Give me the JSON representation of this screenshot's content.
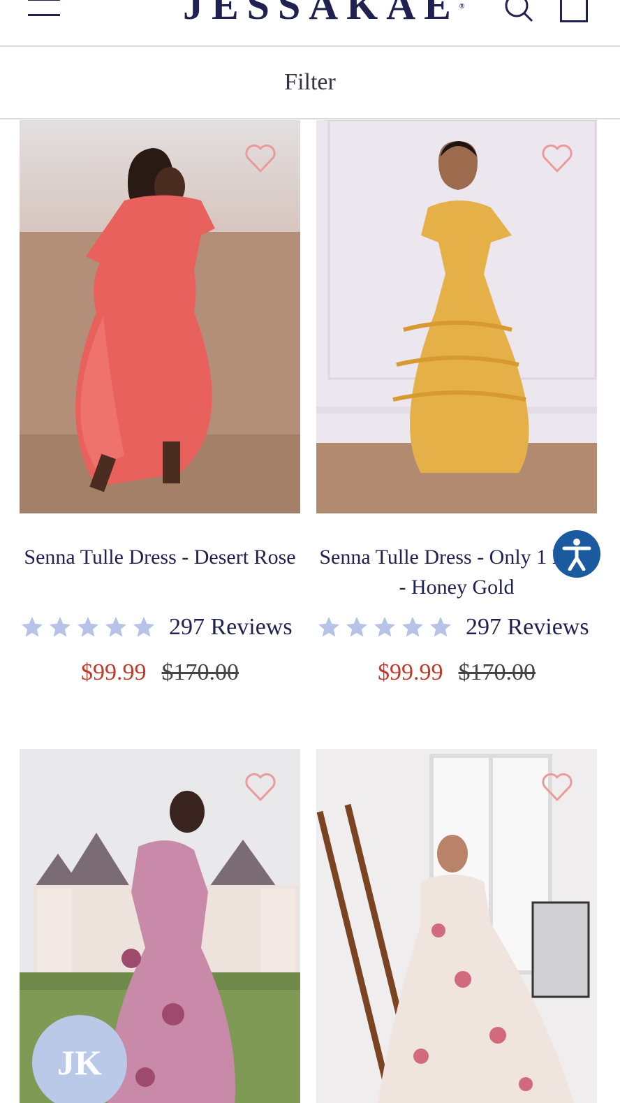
{
  "header": {
    "brand": "JESSAKAE",
    "brand_mark": "®",
    "icons": [
      "menu-icon",
      "search-icon",
      "cart-icon"
    ]
  },
  "filter": {
    "label": "Filter"
  },
  "products": [
    {
      "name": "Senna Tulle Dress - Desert Rose",
      "rating": 5,
      "reviews": "297 Reviews",
      "sale_price": "$99.99",
      "original_price": "$170.00"
    },
    {
      "name": "Senna Tulle Dress - Only 1 Left! - Honey Gold",
      "rating": 5,
      "reviews": "297 Reviews",
      "sale_price": "$99.99",
      "original_price": "$170.00"
    },
    {
      "name": "",
      "rating": null,
      "reviews": "",
      "sale_price": "",
      "original_price": ""
    },
    {
      "name": "",
      "rating": null,
      "reviews": "",
      "sale_price": "",
      "original_price": ""
    }
  ],
  "widgets": {
    "accessibility": "accessibility-icon",
    "chat_initials": "JK"
  },
  "colors": {
    "brand_navy": "#1f2150",
    "sale_red": "#c23a2b",
    "star": "#b4c3e6",
    "heart": "#e99a9a"
  }
}
